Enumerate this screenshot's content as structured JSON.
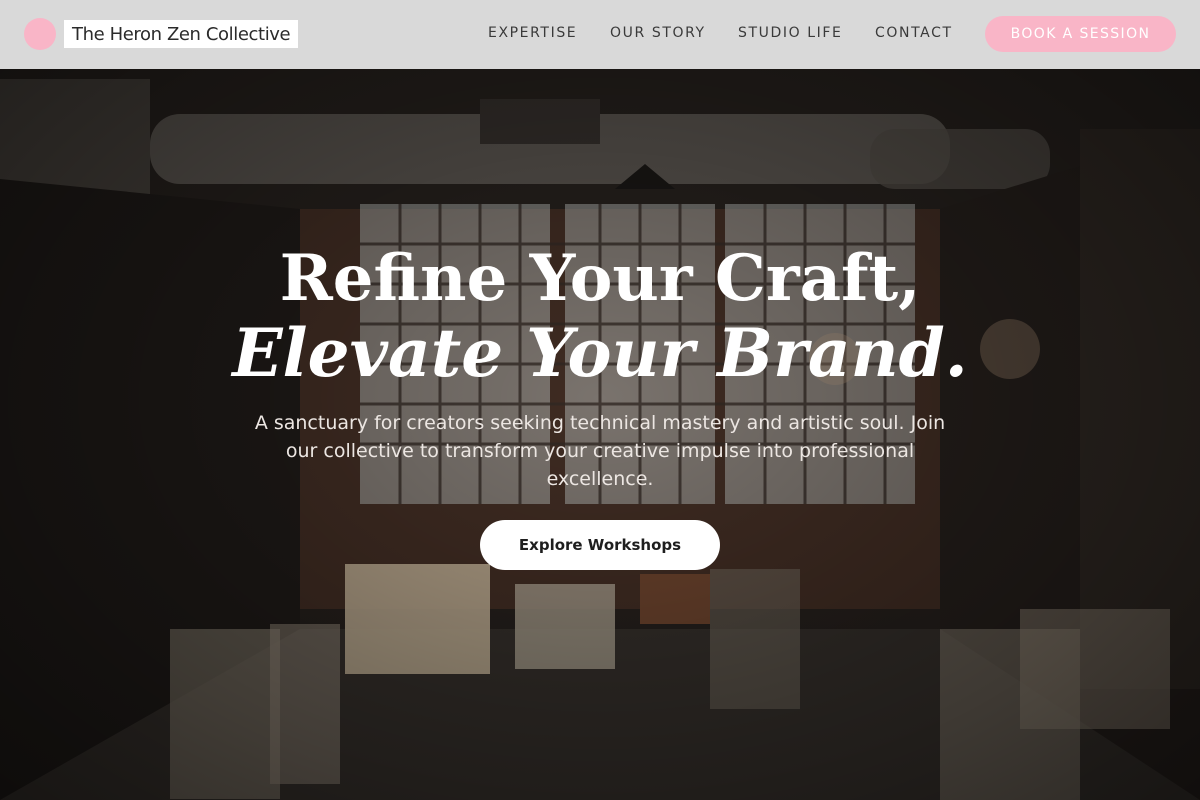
{
  "brand": {
    "name": "The Heron Zen Collective",
    "logo_color": "#f9b5c7"
  },
  "nav": {
    "links": [
      "EXPERTISE",
      "OUR STORY",
      "STUDIO LIFE",
      "CONTACT"
    ],
    "cta_label": "BOOK A SESSION",
    "cta_color": "#f9b5c7",
    "bar_color": "#d9d9d9"
  },
  "hero": {
    "headline_line1": "Refine Your Craft,",
    "headline_line2": "Elevate Your Brand.",
    "subtext": "A sanctuary for creators seeking technical mastery and artistic soul. Join our collective to transform your creative impulse into professional excellence.",
    "cta_label": "Explore Workshops",
    "background_description_icon": "art-studio-photo"
  }
}
